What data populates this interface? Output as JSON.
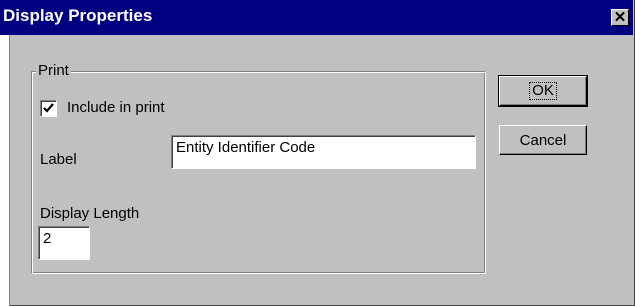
{
  "window": {
    "title": "Display Properties"
  },
  "group": {
    "legend": "Print",
    "include_in_print": {
      "label": "Include in print",
      "checked": true
    },
    "label": {
      "caption": "Label",
      "value": "Entity Identifier Code"
    },
    "display_length": {
      "caption": "Display Length",
      "value": "2"
    }
  },
  "buttons": {
    "ok": "OK",
    "cancel": "Cancel"
  },
  "icons": {
    "close": "close-icon",
    "check": "checkmark-icon"
  }
}
